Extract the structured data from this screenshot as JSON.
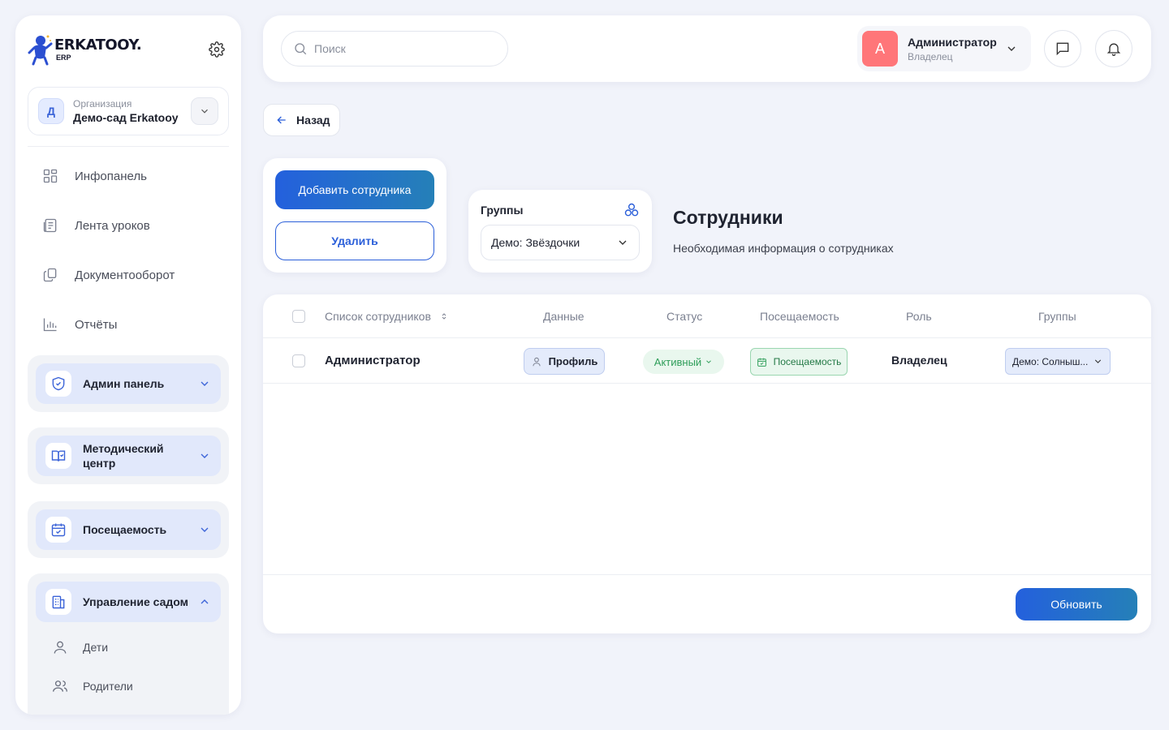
{
  "brand": {
    "name": "ERKATOOY.",
    "sub": "ERP"
  },
  "org": {
    "avatar": "Д",
    "label": "Организация",
    "name": "Демо-сад Erkatooy"
  },
  "nav": [
    {
      "label": "Инфопанель",
      "icon": "grid-icon"
    },
    {
      "label": "Лента уроков",
      "icon": "lessons-icon"
    },
    {
      "label": "Документооборот",
      "icon": "documents-icon"
    },
    {
      "label": "Отчёты",
      "icon": "chart-icon"
    }
  ],
  "groups": [
    {
      "label": "Админ панель",
      "icon": "shield-icon",
      "expanded": false
    },
    {
      "label": "Методический центр",
      "icon": "book-icon",
      "expanded": false
    },
    {
      "label": "Посещаемость",
      "icon": "calendar-icon",
      "expanded": false
    },
    {
      "label": "Управление садом",
      "icon": "building-icon",
      "expanded": true,
      "items": [
        {
          "label": "Дети"
        },
        {
          "label": "Родители"
        }
      ]
    }
  ],
  "search": {
    "placeholder": "Поиск"
  },
  "user": {
    "avatar": "А",
    "name": "Администратор",
    "role": "Владелец"
  },
  "back": {
    "label": "Назад"
  },
  "actions": {
    "add_label": "Добавить сотрудника",
    "delete_label": "Удалить"
  },
  "group_filter": {
    "title": "Группы",
    "selected": "Демо: Звёздочки"
  },
  "page": {
    "title": "Сотрудники",
    "subtitle": "Необходимая информация о сотрудниках"
  },
  "table": {
    "headers": [
      "Список сотрудников",
      "Данные",
      "Статус",
      "Посещаемость",
      "Роль",
      "Группы"
    ],
    "rows": [
      {
        "name": "Администратор",
        "data": "Профиль",
        "status": "Активный",
        "attendance": "Посещаемость",
        "role": "Владелец",
        "group": "Демо: Солныш..."
      }
    ]
  },
  "refresh": {
    "label": "Обновить"
  },
  "colors": {
    "primary": "#2460dd",
    "accent_gradient_end": "#2580b8",
    "active_green": "#2f9e5a",
    "avatar_red": "#ff7679"
  }
}
